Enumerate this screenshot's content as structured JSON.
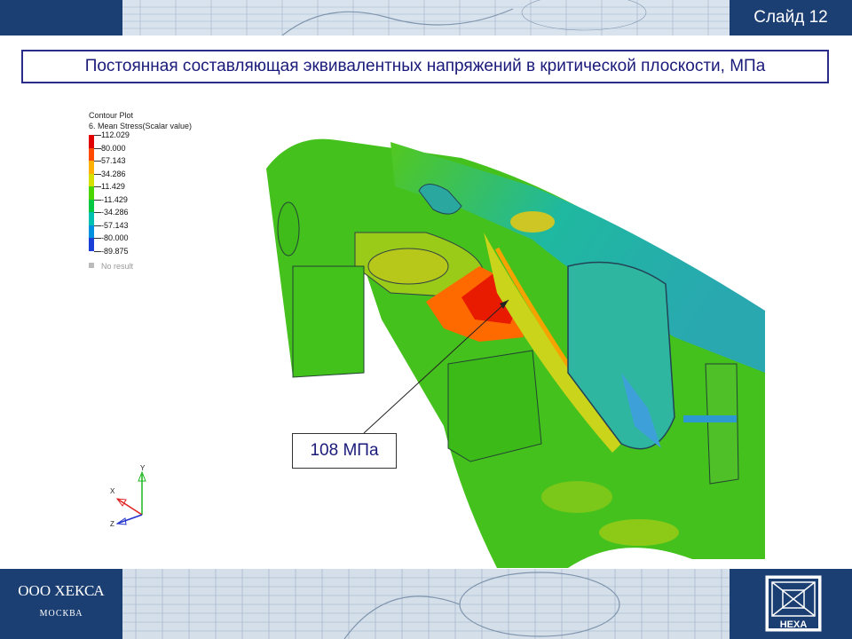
{
  "header": {
    "slide_label": "Слайд 12"
  },
  "title": "Постоянная составляющая эквивалентных напряжений в критической плоскости, МПа",
  "legend": {
    "title_line1": "Contour Plot",
    "title_line2": "6.  Mean Stress(Scalar value)",
    "ticks": [
      {
        "value": "112.029",
        "color": "#e00000"
      },
      {
        "value": "80.000",
        "color": "#ff4a00"
      },
      {
        "value": "57.143",
        "color": "#ffb000"
      },
      {
        "value": "34.286",
        "color": "#d6e000"
      },
      {
        "value": "11.429",
        "color": "#4ad400"
      },
      {
        "value": "-11.429",
        "color": "#00c840"
      },
      {
        "value": "-34.286",
        "color": "#00c0b0"
      },
      {
        "value": "-57.143",
        "color": "#0090e0"
      },
      {
        "value": "-80.000",
        "color": "#1a3fd8"
      },
      {
        "value": "-89.875",
        "color": "#aaaaaa"
      }
    ],
    "no_result": "No result"
  },
  "axes": {
    "x": "X",
    "y": "Y",
    "z": "Z"
  },
  "callout": {
    "text": "108 МПа"
  },
  "footer": {
    "company": "ООО ХЕКСА",
    "city": "МОСКВА",
    "logo_text": "HEXA"
  },
  "colors": {
    "brand_blue": "#1c3f73",
    "title_border": "#2a2c8a"
  }
}
